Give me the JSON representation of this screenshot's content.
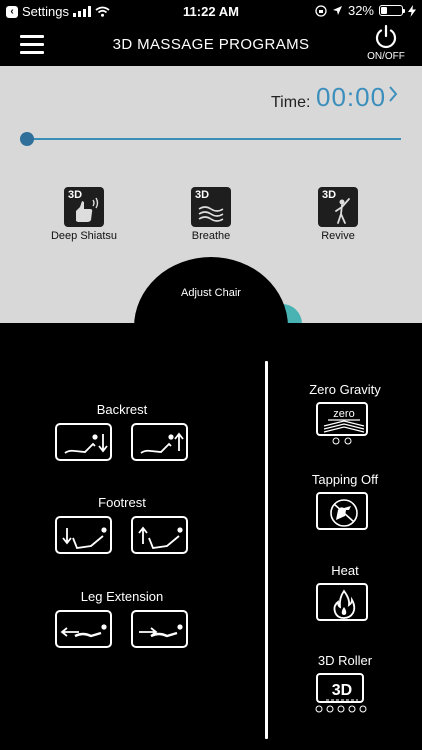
{
  "status_bar": {
    "back_label": "Settings",
    "time": "11:22 AM",
    "battery_percent": "32%",
    "battery_level": 0.32
  },
  "header": {
    "title": "3D MASSAGE PROGRAMS",
    "power_label": "ON/OFF"
  },
  "timer": {
    "label": "Time:",
    "value": "00:00",
    "slider_level": 0.0
  },
  "programs": [
    {
      "tag": "3D",
      "label": "Deep Shiatsu",
      "icon": "shiatsu-hand-icon"
    },
    {
      "tag": "3D",
      "label": "Breathe",
      "icon": "breathe-waves-icon"
    },
    {
      "tag": "3D",
      "label": "Revive",
      "icon": "revive-figure-icon"
    }
  ],
  "adjust_chair": {
    "label": "Adjust Chair"
  },
  "chair_controls": [
    {
      "title": "Backrest",
      "buttons": [
        "backrest-recline-icon",
        "backrest-raise-icon"
      ]
    },
    {
      "title": "Footrest",
      "buttons": [
        "footrest-lower-icon",
        "footrest-raise-icon"
      ]
    },
    {
      "title": "Leg Extension",
      "buttons": [
        "leg-retract-icon",
        "leg-extend-icon"
      ]
    }
  ],
  "features": [
    {
      "title": "Zero Gravity",
      "icon": "zero-gravity-icon",
      "icon_text": "zero"
    },
    {
      "title": "Tapping Off",
      "icon": "tapping-icon"
    },
    {
      "title": "Heat",
      "icon": "flame-icon"
    },
    {
      "title": "3D Roller",
      "icon": "3d-roller-icon",
      "icon_text": "3D"
    }
  ],
  "colors": {
    "accent_blue": "#3c8fbd",
    "panel_gray": "#d8d8d8",
    "knob_teal": "#49b3b3"
  }
}
